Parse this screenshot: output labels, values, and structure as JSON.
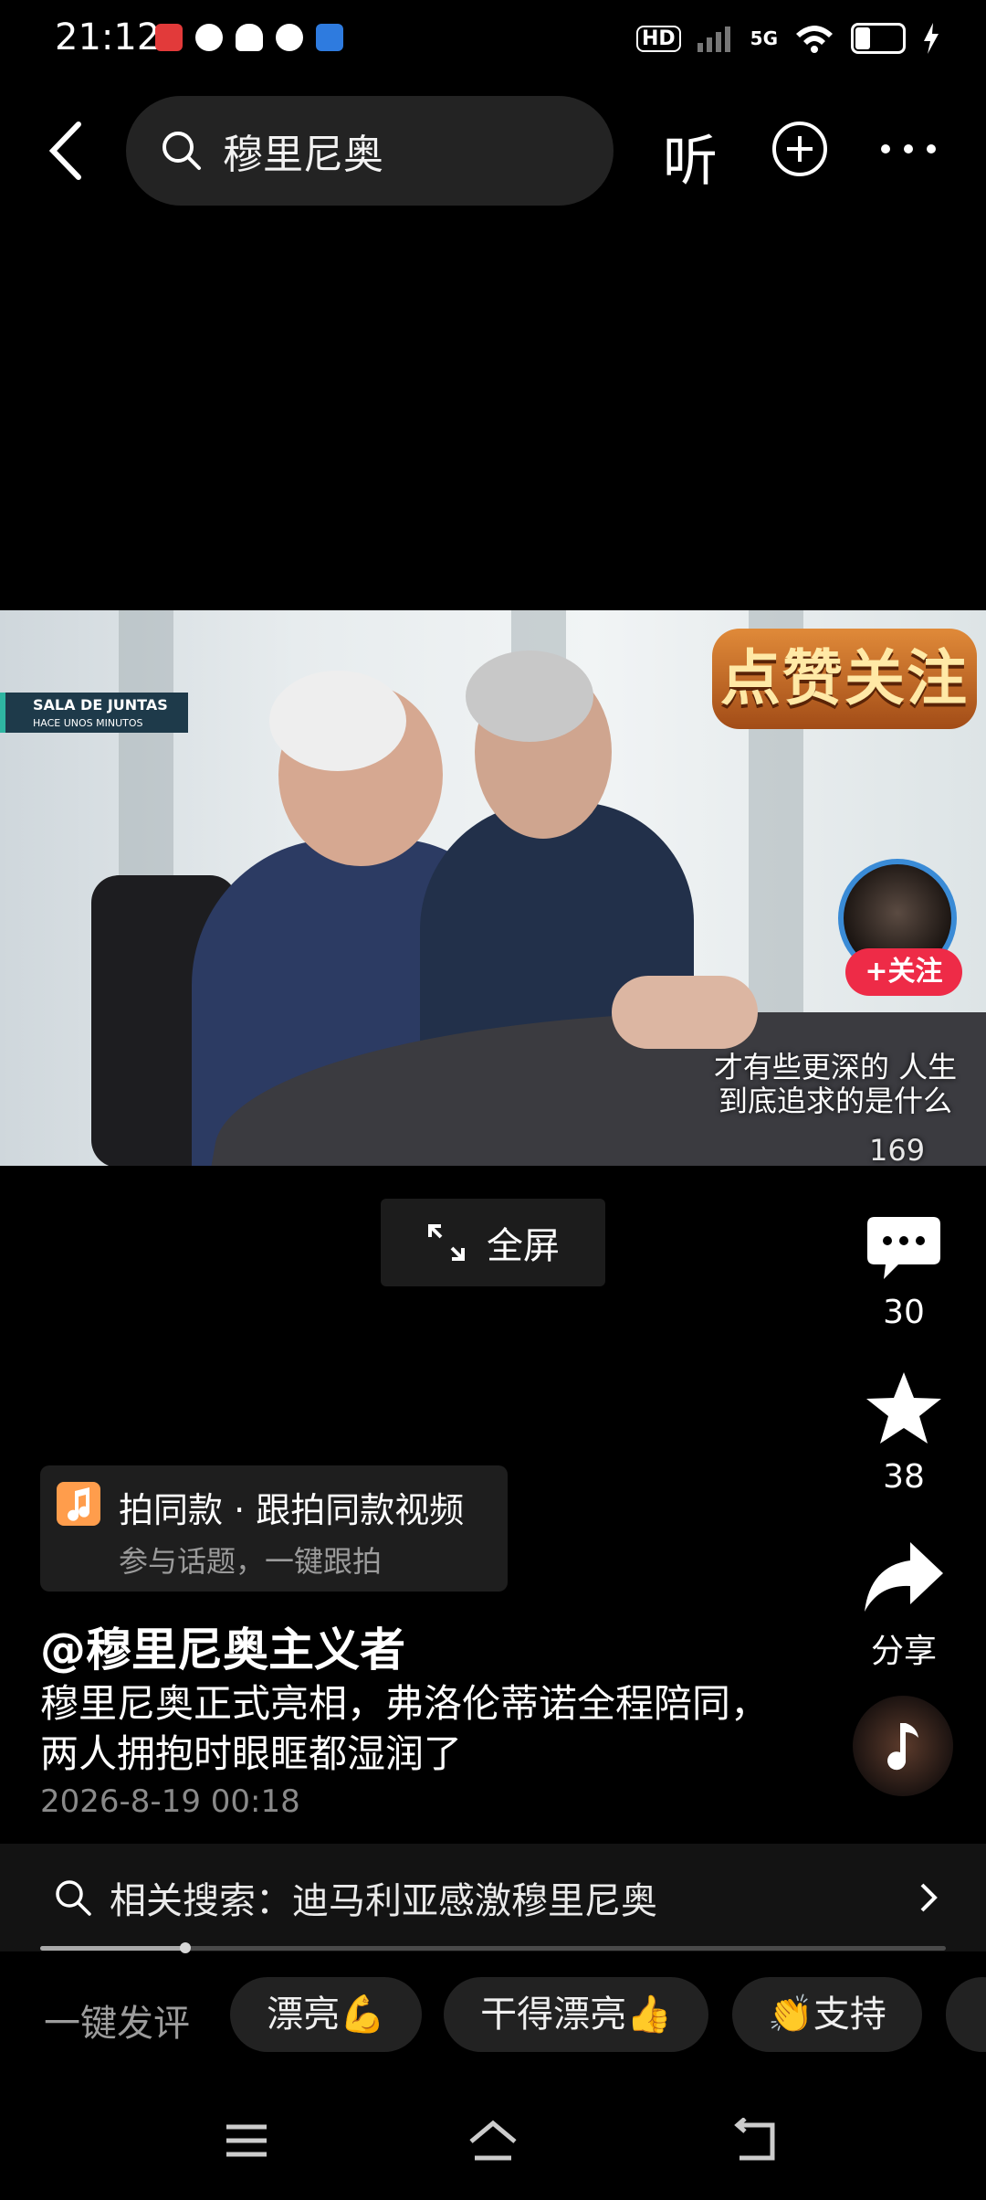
{
  "status_bar": {
    "time": "21:12",
    "hd_label": "HD",
    "network": "5G"
  },
  "header": {
    "search_query": "穆里尼奥",
    "listen_label": "听"
  },
  "video": {
    "sign_title": "SALA DE JUNTAS",
    "sign_subtitle": "HACE UNOS MINUTOS",
    "promo_text": "点赞关注",
    "follow_label": "+关注",
    "caption_overlay": "才有些更深的 人生到底追求的是什么",
    "like_count": "169",
    "fullscreen_label": "全屏"
  },
  "rail": {
    "comments_count": "30",
    "favorites_count": "38",
    "share_label": "分享"
  },
  "music_card": {
    "title": "拍同款 · 跟拍同款视频",
    "subtitle": "参与话题，一键跟拍"
  },
  "post": {
    "author": "@穆里尼奥主义者",
    "description": "穆里尼奥正式亮相，弗洛伦蒂诺全程陪同，两人拥抱时眼眶都湿润了",
    "date": "2026-8-19 00:18"
  },
  "related_search": {
    "label": "相关搜索：迪马利亚感激穆里尼奥"
  },
  "progress": {
    "fraction": 0.16
  },
  "quick_comments": {
    "label": "一键发评",
    "chips": [
      "漂亮💪",
      "干得漂亮👍",
      "👏支持"
    ]
  },
  "colors": {
    "accent": "#ee2b47",
    "background": "#000000"
  }
}
